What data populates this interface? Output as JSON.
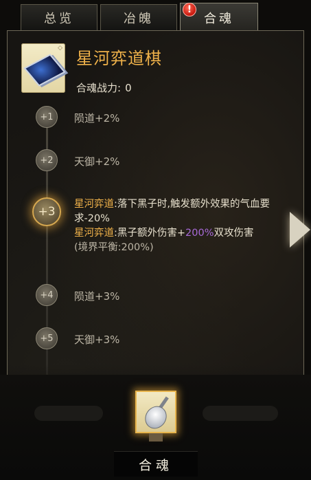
{
  "tabs": [
    {
      "label": "总览"
    },
    {
      "label": "冶魄"
    },
    {
      "label": "合魂"
    }
  ],
  "tab_alert": "!",
  "item": {
    "name": "星河弈道棋",
    "power_label": "合魂战力:",
    "power_value": "0"
  },
  "levels": [
    {
      "node": "+1",
      "text": "陨道+2%"
    },
    {
      "node": "+2",
      "text": "天御+2%"
    },
    {
      "node": "+3"
    },
    {
      "node": "+4",
      "text": "陨道+3%"
    },
    {
      "node": "+5",
      "text": "天御+3%"
    }
  ],
  "detail": {
    "skill1": "星河弈道",
    "text1": ":落下黑子时,触发额外效果的气血要求-20%",
    "skill2": "星河弈道",
    "text2a": ":黑子额外伤害+",
    "highlight": "200%",
    "text2b": "双攻伤害",
    "note": "(境界平衡:200%)"
  },
  "merge_button": "合魂",
  "colors": {
    "accent": "#f0b24a",
    "purple": "#a86ad8"
  }
}
